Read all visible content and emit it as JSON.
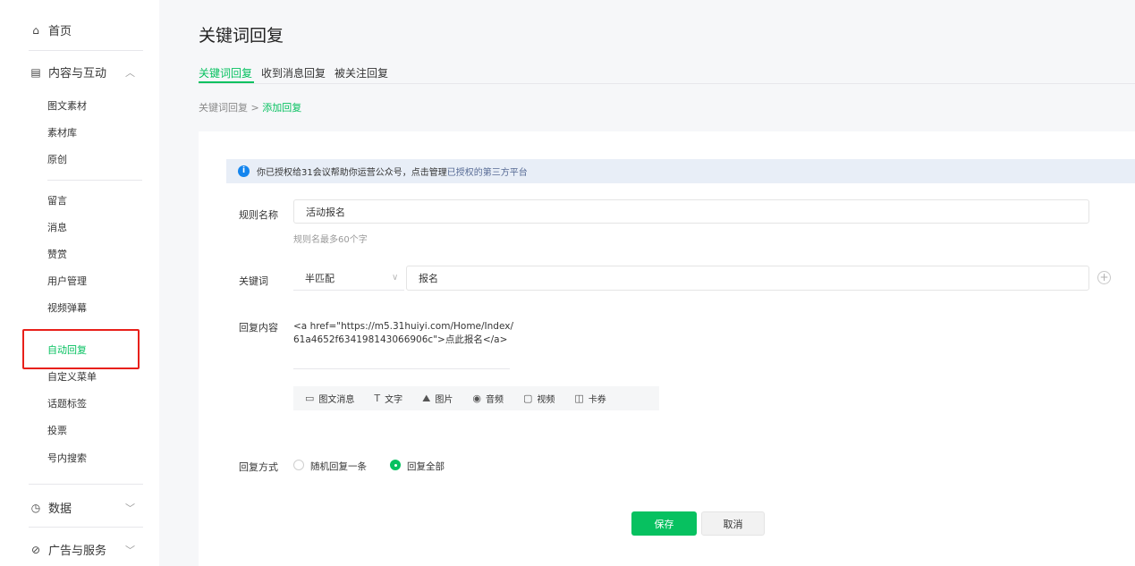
{
  "sidebar": {
    "home": {
      "icon": "home-icon",
      "label": "首页"
    },
    "content": {
      "icon": "document-icon",
      "label": "内容与互动"
    },
    "content_items_a": [
      "图文素材",
      "素材库",
      "原创"
    ],
    "content_items_b": [
      "留言",
      "消息",
      "赞赏",
      "用户管理",
      "视频弹幕"
    ],
    "auto_reply": "自动回复",
    "content_items_c": [
      "自定义菜单",
      "话题标签",
      "投票",
      "号内搜索"
    ],
    "data": {
      "icon": "clock-icon",
      "label": "数据"
    },
    "ads": {
      "icon": "compass-icon",
      "label": "广告与服务"
    }
  },
  "main": {
    "title": "关键词回复",
    "tabs": [
      "关键词回复",
      "收到消息回复",
      "被关注回复"
    ],
    "breadcrumb": {
      "parent": "关键词回复",
      "sep": ">",
      "current": "添加回复"
    }
  },
  "notice": {
    "text": "你已授权给31会议帮助你运营公众号，点击管理",
    "link": "已授权的第三方平台"
  },
  "form": {
    "rule_name_label": "规则名称",
    "rule_name_value": "活动报名",
    "rule_name_hint": "规则名最多60个字",
    "keyword_label": "关键词",
    "match_type": "半匹配",
    "keyword_value": "报名",
    "reply_label": "回复内容",
    "reply_line1": "<a href=\"https://m5.31huiyi.com/Home/Index/",
    "reply_line2": "61a4652f634198143066906c\">点此报名</a>",
    "toolbar": [
      {
        "icon": "news-icon",
        "label": "图文消息"
      },
      {
        "icon": "text-icon",
        "label": "文字"
      },
      {
        "icon": "image-icon",
        "label": "图片"
      },
      {
        "icon": "audio-icon",
        "label": "音频"
      },
      {
        "icon": "video-icon",
        "label": "视频"
      },
      {
        "icon": "coupon-icon",
        "label": "卡券"
      }
    ],
    "reply_mode_label": "回复方式",
    "reply_modes": [
      "随机回复一条",
      "回复全部"
    ],
    "selected_mode": "回复全部"
  },
  "buttons": {
    "save": "保存",
    "cancel": "取消"
  },
  "colors": {
    "accent": "#07c160",
    "highlight": "#e8201a",
    "info": "#1485ee",
    "link": "#576b95"
  }
}
